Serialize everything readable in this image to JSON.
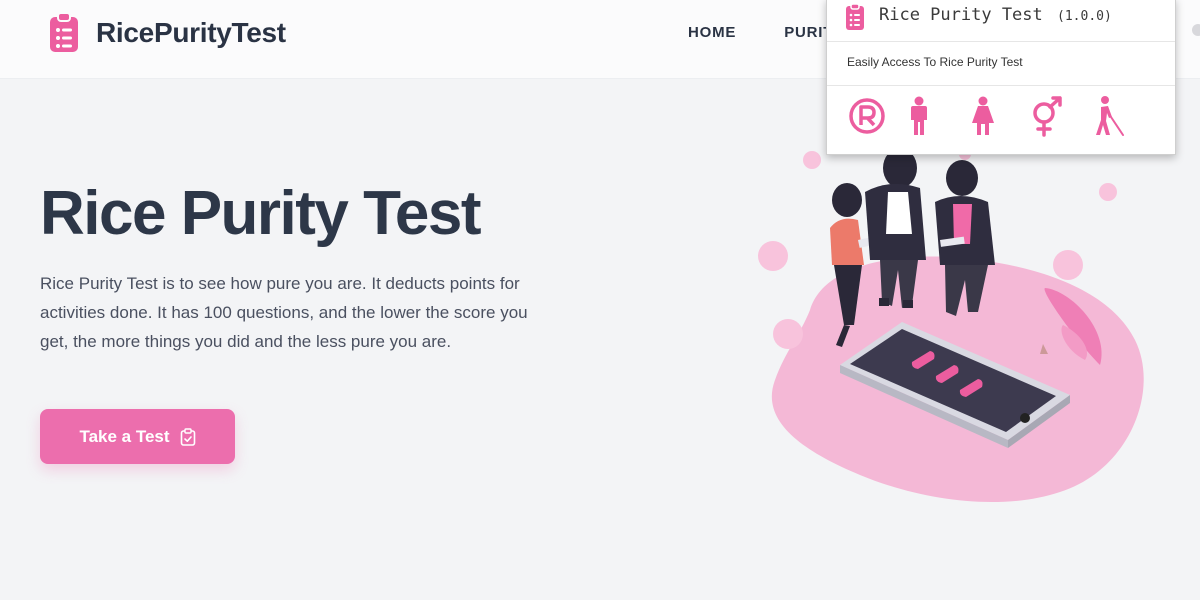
{
  "brand": {
    "name": "RicePurityTest",
    "icon": "clipboard-icon"
  },
  "nav": {
    "items": [
      "HOME",
      "PURITY"
    ]
  },
  "hero": {
    "title": "Rice Purity Test",
    "description": "Rice Purity Test is to see how pure you are. It deducts points for activities done. It has 100 questions, and the lower the score you get, the more things you did and the less pure you are.",
    "cta_label": "Take a Test",
    "cta_icon": "clipboard-check-icon"
  },
  "popup": {
    "title": "Rice Purity Test",
    "version": "(1.0.0)",
    "subtitle": "Easily Access To Rice Purity Test",
    "icons": [
      "registered-icon",
      "male-icon",
      "female-icon",
      "gender-icon",
      "walking-cane-icon"
    ]
  },
  "colors": {
    "accent": "#ec6ead",
    "text_dark": "#2d3748",
    "illustration_pink": "#f4b8d6"
  }
}
